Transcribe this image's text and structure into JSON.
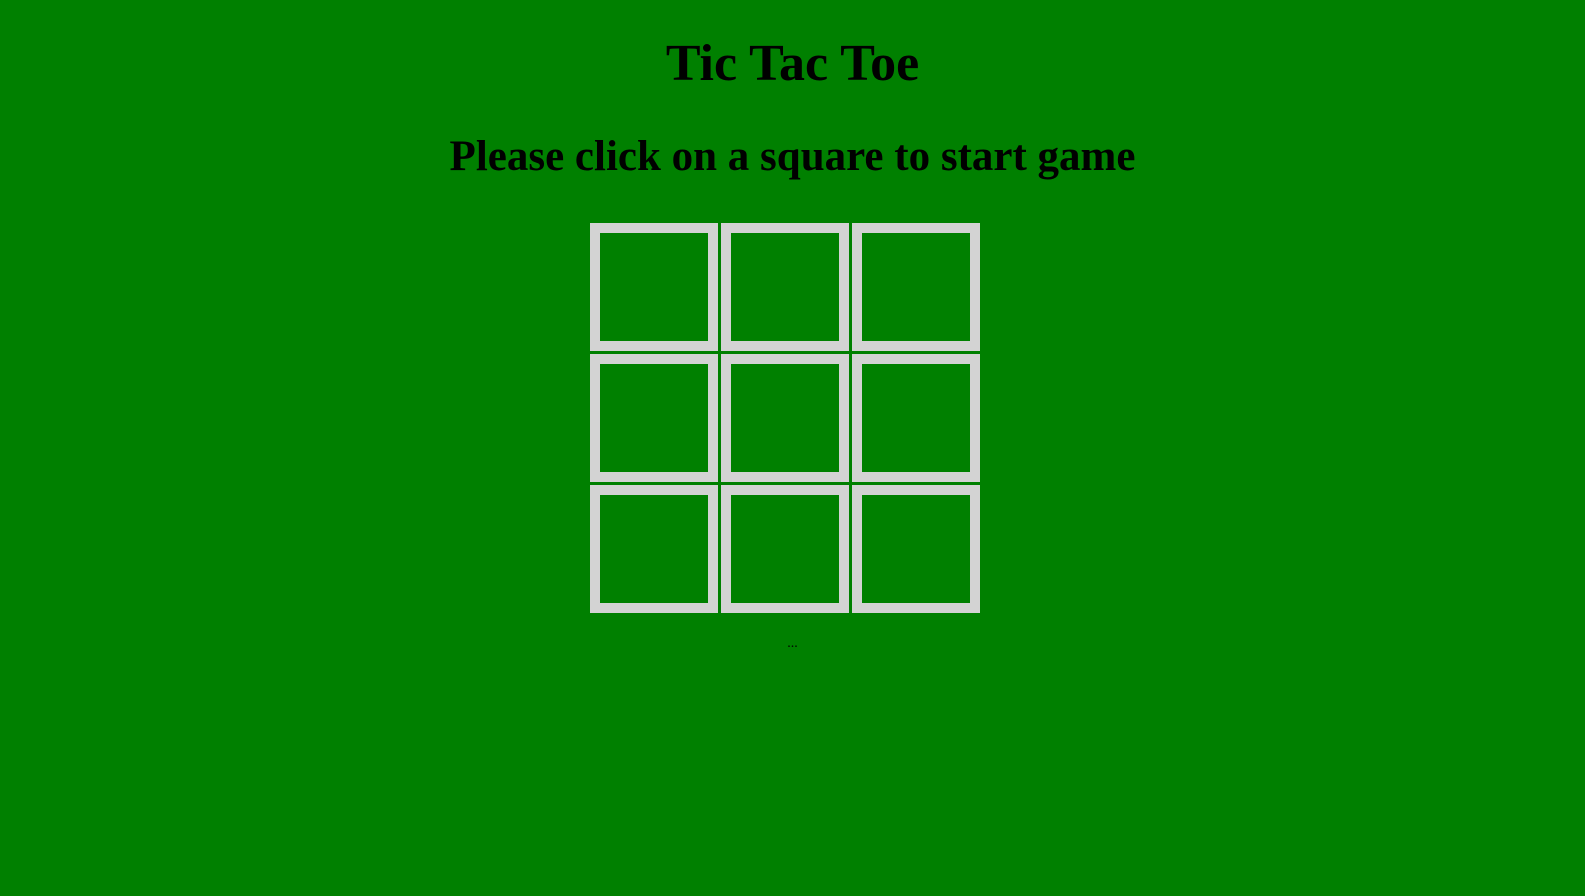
{
  "header": {
    "title": "Tic Tac Toe",
    "status": "Please click on a square to start game"
  },
  "board": {
    "cells": [
      "",
      "",
      "",
      "",
      "",
      "",
      "",
      "",
      ""
    ]
  },
  "footer": {
    "text": "..."
  },
  "colors": {
    "background": "#008000",
    "cell_border": "#d3d3d3",
    "text": "#000000"
  }
}
